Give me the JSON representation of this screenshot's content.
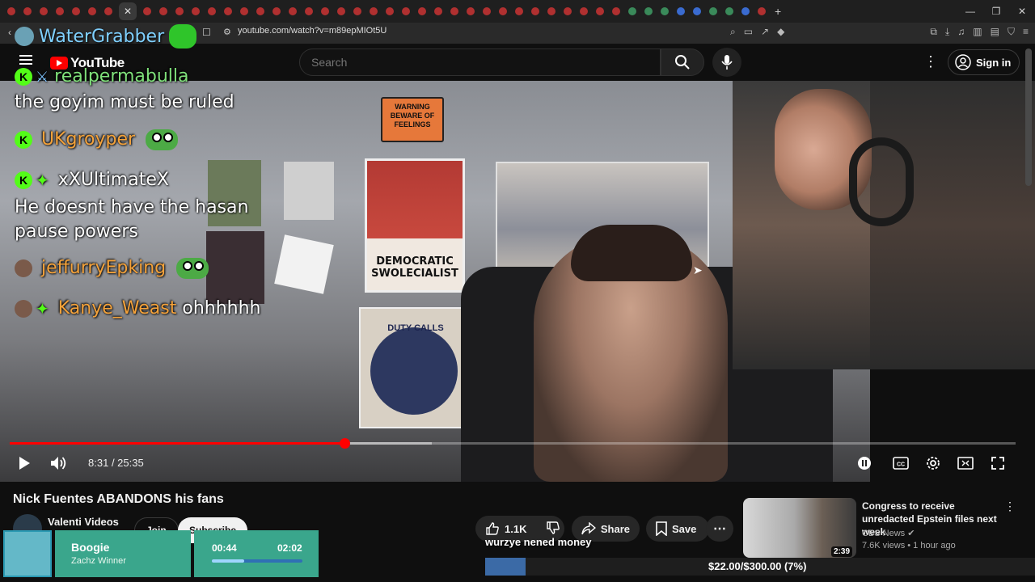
{
  "browser": {
    "url": "youtube.com/watch?v=m89epMIOt5U",
    "window_controls": [
      "—",
      "❐",
      "✕"
    ]
  },
  "masthead": {
    "logo_text": "YouTube",
    "search_placeholder": "Search",
    "signin_label": "Sign in"
  },
  "stream_chat": {
    "header_user": "WaterGrabber",
    "messages": [
      {
        "user": "realpermabulla",
        "text": "the goyim must be ruled"
      },
      {
        "user": "UKgroyper",
        "text": ""
      },
      {
        "user": "xXUltimateX",
        "text": "He doesnt have the hasan pause powers"
      },
      {
        "user": "jeffurryEpking",
        "text": ""
      },
      {
        "user": "Kanye_Weast",
        "text": "ohhhhhh"
      }
    ]
  },
  "wall": {
    "warning": "WARNING BEWARE OF FEELINGS",
    "poster": "DEMOCRATIC SWOLECIALIST",
    "duty": "DUTY CALLS"
  },
  "player": {
    "time_current": "8:31",
    "time_total": "25:35",
    "progress_played": 0.333,
    "progress_loaded": 0.42
  },
  "video": {
    "title": "Nick Fuentes ABANDONS his fans",
    "channel": "Valenti Videos",
    "join_label": "Join",
    "subscribe_label": "Subscribe",
    "likes": "1.1K",
    "share_label": "Share",
    "save_label": "Save"
  },
  "overlay": {
    "caption": "wurzye nened money",
    "goal_text": "$22.00/$300.00 (7%)",
    "goal_fraction": 0.073,
    "boogie_name": "Boogie",
    "boogie_sub": "Zachz Winner",
    "timer_start": "00:44",
    "timer_end": "02:02",
    "timer_fraction": 0.36
  },
  "recommended": {
    "title": "Congress to receive unredacted Epstein files next week",
    "channel": "CBS News",
    "meta": "7.6K views • 1 hour ago",
    "duration": "2:39"
  },
  "colors": {
    "accent": "#ff0000",
    "kick_green": "#53fc18",
    "widget_teal": "#3aa68c"
  }
}
